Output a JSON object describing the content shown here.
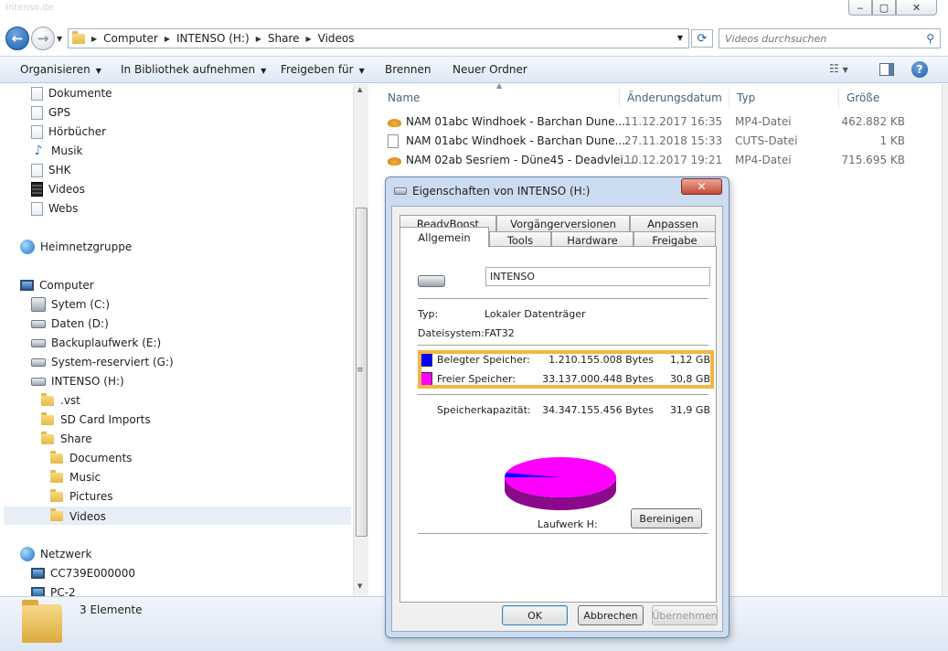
{
  "titlebar": {
    "faded_text": "Intenso.de",
    "min": "‒",
    "max": "▢",
    "close": "✕"
  },
  "address": {
    "crumbs": [
      "Computer",
      "INTENSO (H:)",
      "Share",
      "Videos"
    ],
    "search_placeholder": "Videos durchsuchen"
  },
  "toolbar": {
    "organize": "Organisieren",
    "add_library": "In Bibliothek aufnehmen",
    "share": "Freigeben für",
    "burn": "Brennen",
    "new_folder": "Neuer Ordner"
  },
  "nav": {
    "libraries": [
      "Dokumente",
      "GPS",
      "Hörbücher",
      "Musik",
      "SHK",
      "Videos",
      "Webs"
    ],
    "homegroup": "Heimnetzgruppe",
    "computer": "Computer",
    "drives": [
      "Sytem (C:)",
      "Daten (D:)",
      "Backuplaufwerk (E:)",
      "System-reserviert (G:)",
      "INTENSO (H:)"
    ],
    "intenso_children": [
      ".vst",
      "SD Card Imports",
      "Share"
    ],
    "share_children": [
      "Documents",
      "Music",
      "Pictures",
      "Videos"
    ],
    "network": "Netzwerk",
    "network_items": [
      "CC739E000000",
      "PC-2"
    ]
  },
  "filelist": {
    "headers": {
      "name": "Name",
      "date": "Änderungsdatum",
      "type": "Typ",
      "size": "Größe"
    },
    "rows": [
      {
        "name": "NAM 01abc Windhoek - Barchan Dune....",
        "date": "11.12.2017 16:35",
        "type": "MP4-Datei",
        "size": "462.882 KB",
        "icon": "video-file-icon"
      },
      {
        "name": "NAM 01abc Windhoek - Barchan Dune....",
        "date": "27.11.2018 15:33",
        "type": "CUTS-Datei",
        "size": "1 KB",
        "icon": "generic-file-icon"
      },
      {
        "name": "NAM 02ab Sesriem - Düne45 - Deadvlei....",
        "date": "10.12.2017 19:21",
        "type": "MP4-Datei",
        "size": "715.695 KB",
        "icon": "video-file-icon"
      }
    ]
  },
  "status": {
    "count": "3 Elemente"
  },
  "dialog": {
    "title": "Eigenschaften von INTENSO (H:)",
    "tabs_row1": [
      "ReadyBoost",
      "Vorgängerversionen",
      "Anpassen"
    ],
    "tabs_row2": [
      "Allgemein",
      "Tools",
      "Hardware",
      "Freigabe"
    ],
    "drive_name": "INTENSO",
    "type_label": "Typ:",
    "type_value": "Lokaler Datenträger",
    "fs_label": "Dateisystem:",
    "fs_value": "FAT32",
    "used_label": "Belegter Speicher:",
    "used_bytes": "1.210.155.008 Bytes",
    "used_gb": "1,12 GB",
    "free_label": "Freier Speicher:",
    "free_bytes": "33.137.000.448 Bytes",
    "free_gb": "30,8 GB",
    "capacity_label": "Speicherkapazität:",
    "capacity_bytes": "34.347.155.456 Bytes",
    "capacity_gb": "31,9 GB",
    "drive_label": "Laufwerk H:",
    "cleanup": "Bereinigen",
    "ok": "OK",
    "cancel": "Abbrechen",
    "apply": "Übernehmen",
    "used_color": "#0000ff",
    "free_color": "#ff00ff",
    "used_fraction": 0.0352
  },
  "colors": {
    "highlight": "#f4b446",
    "accent": "#1f5fa8"
  }
}
